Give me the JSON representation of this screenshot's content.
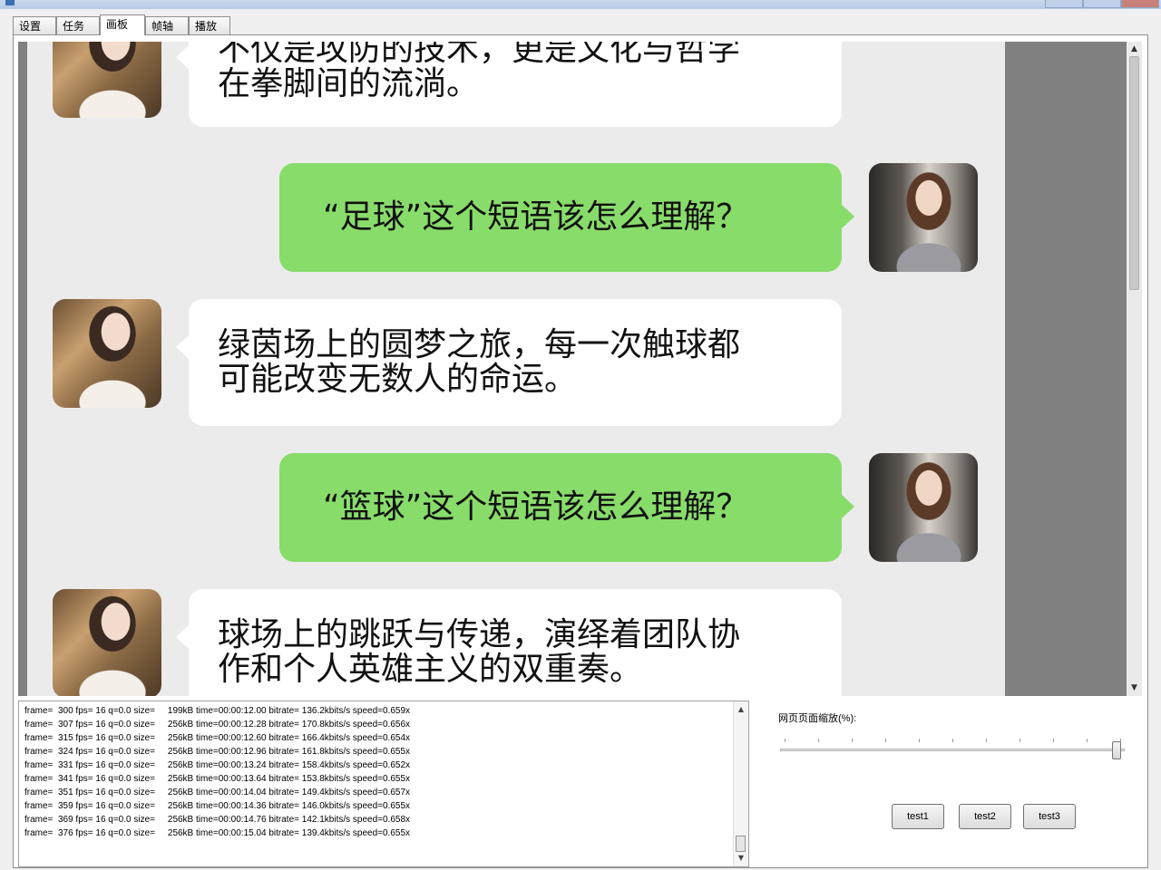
{
  "tabs": [
    {
      "label": "设置"
    },
    {
      "label": "任务"
    },
    {
      "label": "画板",
      "active": true
    },
    {
      "label": "帧轴"
    },
    {
      "label": "播放"
    }
  ],
  "chat": {
    "messages": [
      {
        "side": "left",
        "lines": [
          "不仅是攻防的技术，更是文化与哲学",
          "在拳脚间的流淌。"
        ]
      },
      {
        "side": "right",
        "lines": [
          "“足球”这个短语该怎么理解？"
        ]
      },
      {
        "side": "left",
        "lines": [
          "绿茵场上的圆梦之旅，每一次触球都",
          "可能改变无数人的命运。"
        ]
      },
      {
        "side": "right",
        "lines": [
          "“篮球”这个短语该怎么理解？"
        ]
      },
      {
        "side": "left",
        "lines": [
          "球场上的跳跃与传递，演绎着团队协",
          "作和个人英雄主义的双重奏。"
        ]
      }
    ]
  },
  "log": {
    "lines": [
      "frame=  300 fps= 16 q=0.0 size=     199kB time=00:00:12.00 bitrate= 136.2kbits/s speed=0.659x",
      "frame=  307 fps= 16 q=0.0 size=     256kB time=00:00:12.28 bitrate= 170.8kbits/s speed=0.656x",
      "frame=  315 fps= 16 q=0.0 size=     256kB time=00:00:12.60 bitrate= 166.4kbits/s speed=0.654x",
      "frame=  324 fps= 16 q=0.0 size=     256kB time=00:00:12.96 bitrate= 161.8kbits/s speed=0.655x",
      "frame=  331 fps= 16 q=0.0 size=     256kB time=00:00:13.24 bitrate= 158.4kbits/s speed=0.652x",
      "frame=  341 fps= 16 q=0.0 size=     256kB time=00:00:13.64 bitrate= 153.8kbits/s speed=0.655x",
      "frame=  351 fps= 16 q=0.0 size=     256kB time=00:00:14.04 bitrate= 149.4kbits/s speed=0.657x",
      "frame=  359 fps= 16 q=0.0 size=     256kB time=00:00:14.36 bitrate= 146.0kbits/s speed=0.655x",
      "frame=  369 fps= 16 q=0.0 size=     256kB time=00:00:14.76 bitrate= 142.1kbits/s speed=0.658x",
      "frame=  376 fps= 16 q=0.0 size=     256kB time=00:00:15.04 bitrate= 139.4kbits/s speed=0.655x"
    ]
  },
  "zoom": {
    "label": "网页页面缩放(%):",
    "level": 1.0
  },
  "buttons": {
    "test1": "test1",
    "test2": "test2",
    "test3": "test3"
  },
  "colors": {
    "bubble_green": "#88dc6a",
    "bubble_white": "#ffffff",
    "canvas_bg": "#ebebeb",
    "viewport_bg": "#808080"
  },
  "icons": {
    "scroll_up": "▲",
    "scroll_down": "▼"
  }
}
